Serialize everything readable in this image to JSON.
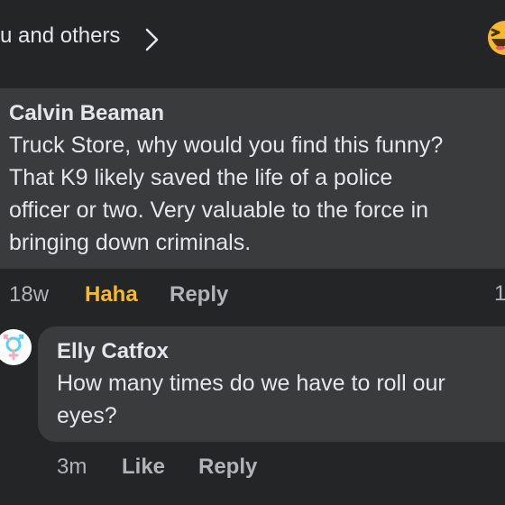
{
  "reactions": {
    "text": "u and others"
  },
  "comment1": {
    "author": "Calvin Beaman",
    "lines": [
      "Truck Store, why would you find this funny?",
      "That K9 likely saved the life of a police",
      "officer or two.  Very valuable to the force in",
      "bringing down criminals."
    ],
    "time": "18w",
    "reaction": "Haha",
    "reply": "Reply",
    "count_partial": "1"
  },
  "comment2": {
    "author": "Elly Catfox",
    "lines": [
      "How many times do we have to roll our",
      "eyes?"
    ],
    "time": "3m",
    "like": "Like",
    "reply": "Reply"
  },
  "colors": {
    "background": "#242527",
    "bubble": "#3a3b3c",
    "text": "#e4e6eb",
    "meta": "#b0b3b8",
    "haha": "#f7b928"
  }
}
